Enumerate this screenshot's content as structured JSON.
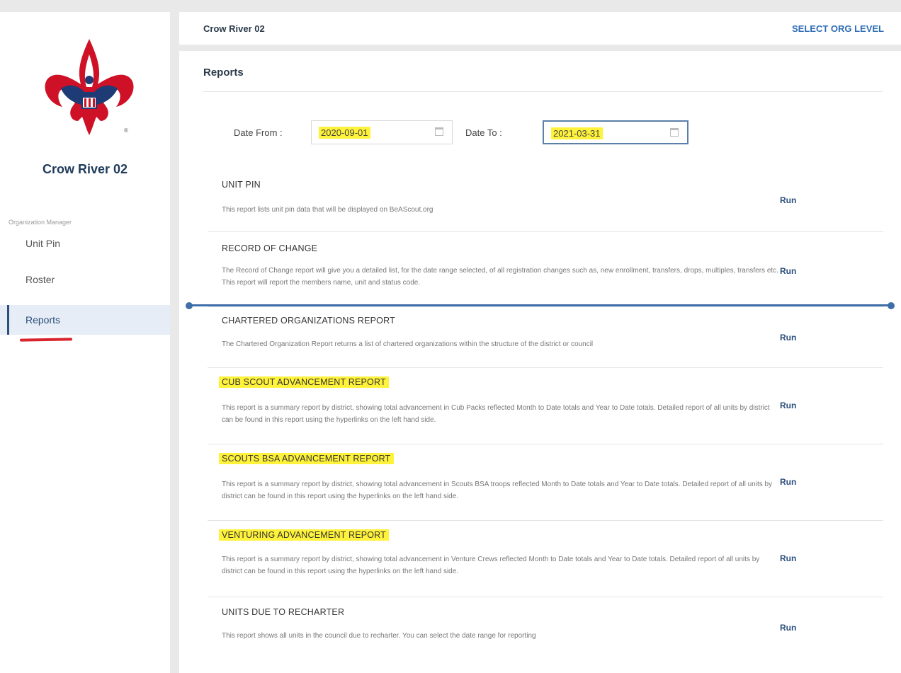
{
  "header": {
    "title": "Crow River 02",
    "action": "SELECT ORG LEVEL"
  },
  "sidebar": {
    "org_name": "Crow River 02",
    "caption": "Organization Manager",
    "items": [
      {
        "label": "Unit Pin"
      },
      {
        "label": "Roster"
      },
      {
        "label": "Reports",
        "active": true
      }
    ]
  },
  "page": {
    "title": "Reports"
  },
  "dates": {
    "from_label": "Date From :",
    "from_value": "2020-09-01",
    "to_label": "Date To :",
    "to_value": "2021-03-31"
  },
  "run_label": "Run",
  "reports": [
    {
      "title": "UNIT PIN",
      "desc": "This report lists unit pin data that will be displayed on BeAScout.org",
      "highlighted": false
    },
    {
      "title": "RECORD OF CHANGE",
      "desc": "The Record of Change report will give you a detailed list, for the date range selected, of all registration changes such as, new enrollment, transfers, drops, multiples, transfers etc. This report will report the members name, unit and status code.",
      "highlighted": false
    },
    {
      "title": "CHARTERED ORGANIZATIONS REPORT",
      "desc": "The Chartered Organization Report returns a list of chartered organizations within the structure of the district or council",
      "highlighted": false
    },
    {
      "title": "CUB SCOUT ADVANCEMENT REPORT",
      "desc": "This report is a summary report by district, showing total advancement in Cub Packs reflected Month to Date totals and Year to Date totals. Detailed report of all units by district can be found in this report using the hyperlinks on the left hand side.",
      "highlighted": true
    },
    {
      "title": "SCOUTS BSA ADVANCEMENT REPORT",
      "desc": "This report is a summary report by district, showing total advancement in Scouts BSA troops reflected Month to Date totals and Year to Date totals. Detailed report of all units by district can be found in this report using the hyperlinks on the left hand side.",
      "highlighted": true
    },
    {
      "title": "VENTURING ADVANCEMENT REPORT",
      "desc": "This report is a summary report by district, showing total advancement in Venture Crews reflected Month to Date totals and Year to Date totals. Detailed report of all units by district can be found in this report using the hyperlinks on the left hand side.",
      "highlighted": true
    },
    {
      "title": "UNITS DUE TO RECHARTER",
      "desc": "This report shows all units in the council due to recharter. You can select the date range for reporting",
      "highlighted": false
    }
  ],
  "colors": {
    "accent": "#2b4f7c",
    "highlight": "#fff23a",
    "annotation_red": "#d8242c",
    "annotation_blue": "#3f6fa8"
  }
}
